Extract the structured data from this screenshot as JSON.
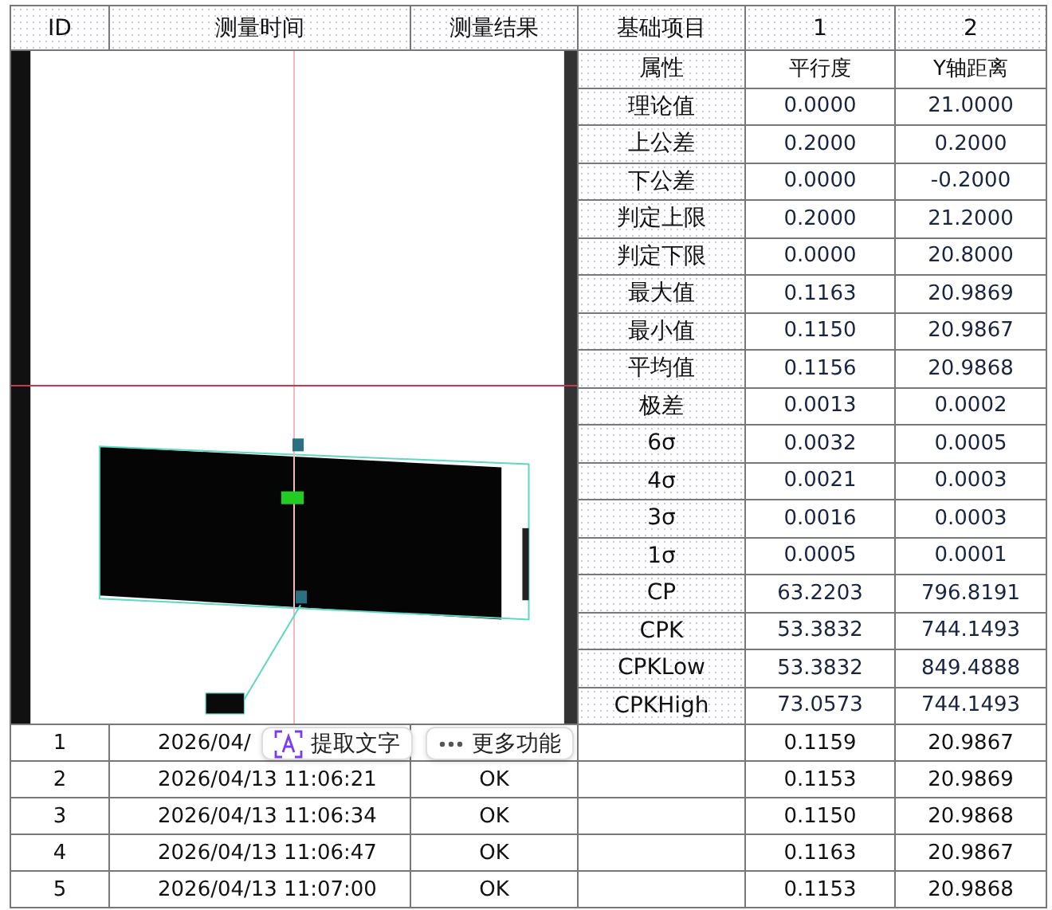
{
  "table": {
    "columns": [
      "ID",
      "测量时间",
      "测量结果",
      "基础项目",
      "1",
      "2"
    ],
    "stats": [
      {
        "label": "属性",
        "values": [
          "平行度",
          "Y轴距离"
        ]
      },
      {
        "label": "理论值",
        "values": [
          "0.0000",
          "21.0000"
        ]
      },
      {
        "label": "上公差",
        "values": [
          "0.2000",
          "0.2000"
        ]
      },
      {
        "label": "下公差",
        "values": [
          "0.0000",
          "-0.2000"
        ]
      },
      {
        "label": "判定上限",
        "values": [
          "0.2000",
          "21.2000"
        ]
      },
      {
        "label": "判定下限",
        "values": [
          "0.0000",
          "20.8000"
        ]
      },
      {
        "label": "最大值",
        "values": [
          "0.1163",
          "20.9869"
        ]
      },
      {
        "label": "最小值",
        "values": [
          "0.1150",
          "20.9867"
        ]
      },
      {
        "label": "平均值",
        "values": [
          "0.1156",
          "20.9868"
        ]
      },
      {
        "label": "极差",
        "values": [
          "0.0013",
          "0.0002"
        ]
      },
      {
        "label": "6σ",
        "values": [
          "0.0032",
          "0.0005"
        ]
      },
      {
        "label": "4σ",
        "values": [
          "0.0021",
          "0.0003"
        ]
      },
      {
        "label": "3σ",
        "values": [
          "0.0016",
          "0.0003"
        ]
      },
      {
        "label": "1σ",
        "values": [
          "0.0005",
          "0.0001"
        ]
      },
      {
        "label": "CP",
        "values": [
          "63.2203",
          "796.8191"
        ]
      },
      {
        "label": "CPK",
        "values": [
          "53.3832",
          "744.1493"
        ]
      },
      {
        "label": "CPKLow",
        "values": [
          "53.3832",
          "849.4888"
        ]
      },
      {
        "label": "CPKHigh",
        "values": [
          "73.0573",
          "744.1493"
        ]
      }
    ],
    "rows": [
      {
        "id": "1",
        "time": "2026/04/",
        "values": [
          "0.1159",
          "20.9867"
        ]
      },
      {
        "id": "2",
        "time": "2026/04/13 11:06:21",
        "result": "OK",
        "values": [
          "0.1153",
          "20.9869"
        ]
      },
      {
        "id": "3",
        "time": "2026/04/13 11:06:34",
        "result": "OK",
        "values": [
          "0.1150",
          "20.9868"
        ]
      },
      {
        "id": "4",
        "time": "2026/04/13 11:06:47",
        "result": "OK",
        "values": [
          "0.1163",
          "20.9867"
        ]
      },
      {
        "id": "5",
        "time": "2026/04/13 11:07:00",
        "result": "OK",
        "values": [
          "0.1153",
          "20.9868"
        ]
      }
    ]
  },
  "floating_toolbar": {
    "buttons": [
      {
        "kind": "extract",
        "label": "提取文字"
      },
      {
        "kind": "more",
        "label": "更多功能"
      }
    ]
  }
}
